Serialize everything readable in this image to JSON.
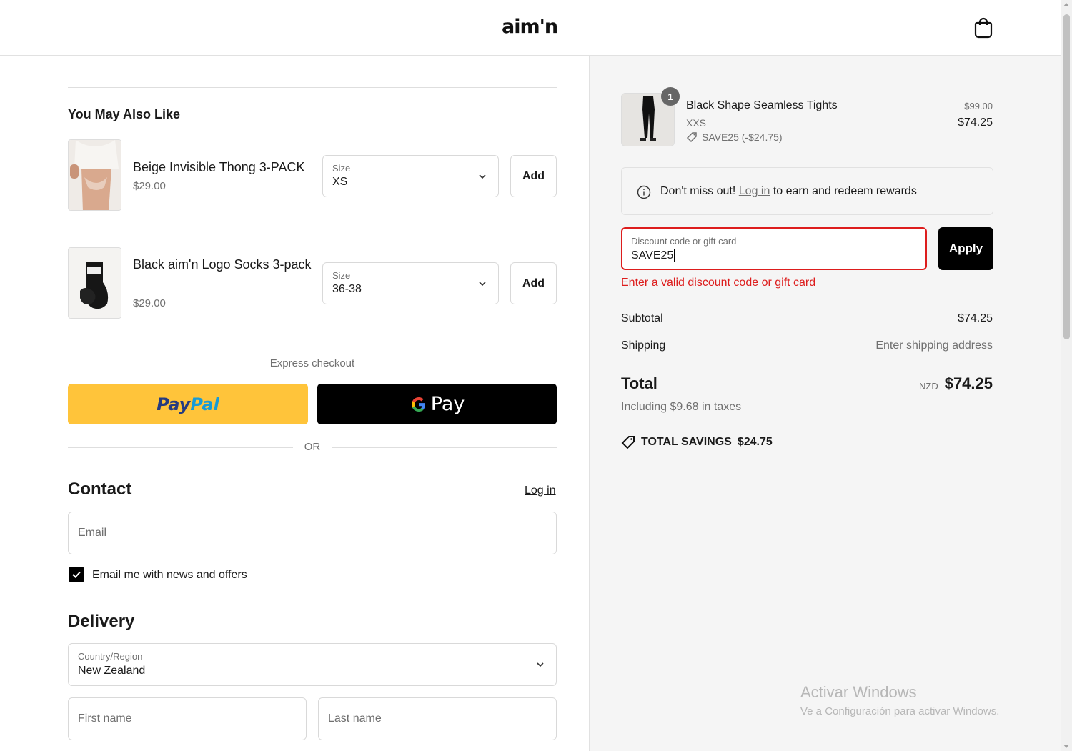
{
  "header": {
    "logo_text": "aim'n",
    "cart_icon": "shopping-bag-icon"
  },
  "upsell": {
    "title": "You May Also Like",
    "items": [
      {
        "name": "Beige Invisible Thong 3-PACK",
        "price": "$29.00",
        "size_label": "Size",
        "size_value": "XS",
        "add_label": "Add"
      },
      {
        "name": "Black aim'n Logo Socks 3-pack",
        "price": "$29.00",
        "size_label": "Size",
        "size_value": "36-38",
        "add_label": "Add"
      }
    ]
  },
  "express": {
    "label": "Express checkout",
    "paypal_text_1": "Pay",
    "paypal_text_2": "Pal",
    "gpay_g": "G",
    "gpay_text": "Pay",
    "or_text": "OR"
  },
  "contact": {
    "title": "Contact",
    "login_label": "Log in",
    "email_placeholder": "Email",
    "newsletter_label": "Email me with news and offers",
    "newsletter_checked": true
  },
  "delivery": {
    "title": "Delivery",
    "country_label": "Country/Region",
    "country_value": "New Zealand",
    "first_name_placeholder": "First name",
    "last_name_placeholder": "Last name"
  },
  "summary": {
    "product": {
      "quantity": "1",
      "name": "Black Shape Seamless Tights",
      "variant": "XXS",
      "discount": "SAVE25 (-$24.75)",
      "original_price": "$99.00",
      "price": "$74.25"
    },
    "rewards": {
      "prefix": "Don't miss out!",
      "link": "Log in",
      "suffix": "to earn and redeem rewards"
    },
    "discount_field": {
      "label": "Discount code or gift card",
      "value": "SAVE25",
      "apply_label": "Apply",
      "error": "Enter a valid discount code or gift card"
    },
    "subtotal_label": "Subtotal",
    "subtotal_value": "$74.25",
    "shipping_label": "Shipping",
    "shipping_value": "Enter shipping address",
    "total_label": "Total",
    "currency": "NZD",
    "total_value": "$74.25",
    "taxes": "Including $9.68 in taxes",
    "savings_label": "TOTAL SAVINGS",
    "savings_value": "$24.75"
  },
  "watermark": {
    "title": "Activar Windows",
    "subtitle": "Ve a Configuración para activar Windows."
  },
  "colors": {
    "accent_error": "#dd1d1d",
    "paypal_yellow": "#ffc43a",
    "summary_bg": "#f5f5f5"
  }
}
